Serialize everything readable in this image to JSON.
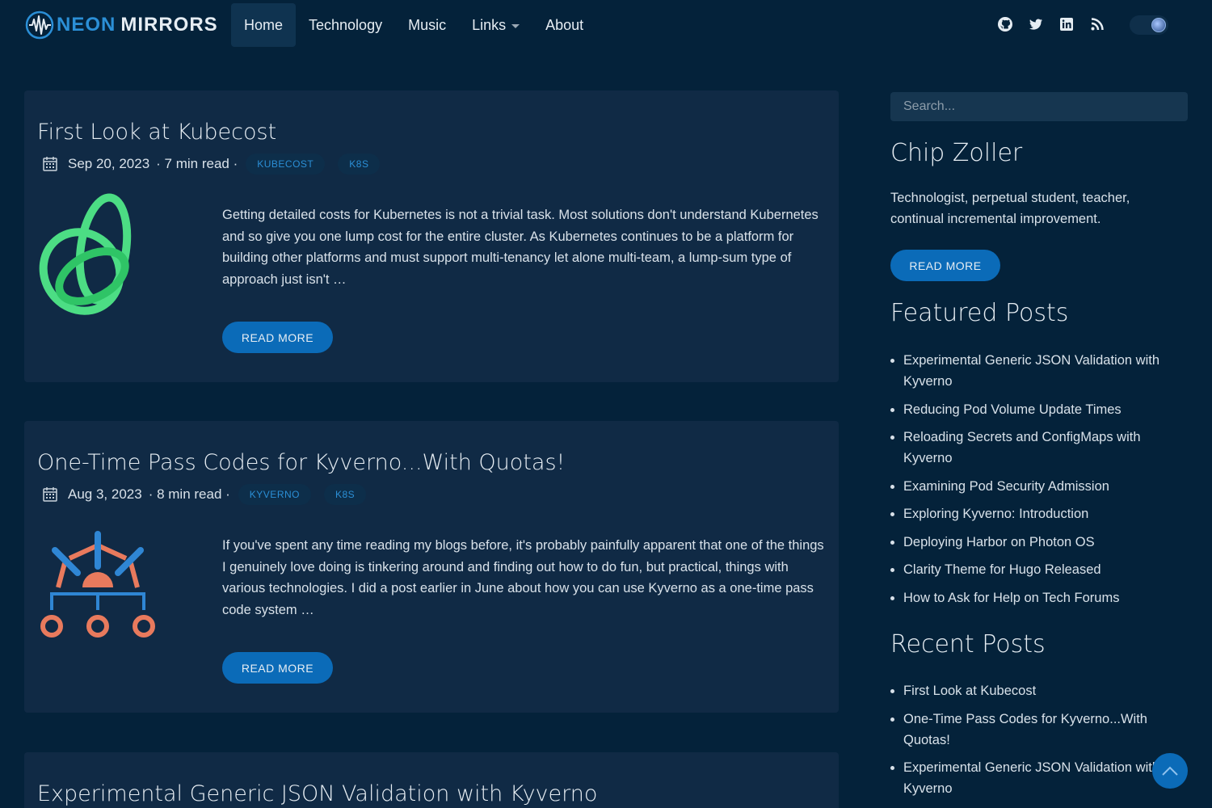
{
  "brand": {
    "neon": "NEON",
    "mirrors": "MIRRORS"
  },
  "nav": {
    "items": [
      {
        "label": "Home",
        "active": true
      },
      {
        "label": "Technology"
      },
      {
        "label": "Music"
      },
      {
        "label": "Links",
        "dropdown": true
      },
      {
        "label": "About"
      }
    ],
    "socials": [
      "github-icon",
      "twitter-icon",
      "linkedin-icon",
      "rss-icon"
    ]
  },
  "posts": [
    {
      "title": "First Look at Kubecost",
      "date": "Sep 20, 2023",
      "read": "· 7 min read ·",
      "tags": [
        "KUBECOST",
        "K8S"
      ],
      "excerpt": "Getting detailed costs for Kubernetes is not a trivial task. Most solutions don't understand Kubernetes and so give you one lump cost for the entire cluster. As Kubernetes continues to be a platform for building other platforms and must support multi-tenancy let alone multi-team, a lump-sum type of approach just isn't …",
      "button": "READ MORE"
    },
    {
      "title": "One-Time Pass Codes for Kyverno...With Quotas!",
      "date": "Aug 3, 2023",
      "read": "· 8 min read ·",
      "tags": [
        "KYVERNO",
        "K8S"
      ],
      "excerpt": "If you've spent any time reading my blogs before, it's probably painfully apparent that one of the things I genuinely love doing is tinkering around and finding out how to do fun, but practical, things with various technologies. I did a post earlier in June about how you can use Kyverno as a one-time pass code system …",
      "button": "READ MORE"
    },
    {
      "title": "Experimental Generic JSON Validation with Kyverno"
    }
  ],
  "sidebar": {
    "search_placeholder": "Search...",
    "author": "Chip Zoller",
    "bio": "Technologist, perpetual student, teacher, continual incremental improvement.",
    "button": "READ MORE",
    "featured_title": "Featured Posts",
    "featured": [
      "Experimental Generic JSON Validation with Kyverno",
      "Reducing Pod Volume Update Times",
      "Reloading Secrets and ConfigMaps with Kyverno",
      "Examining Pod Security Admission",
      "Exploring Kyverno: Introduction",
      "Deploying Harbor on Photon OS",
      "Clarity Theme for Hugo Released",
      "How to Ask for Help on Tech Forums"
    ],
    "recent_title": "Recent Posts",
    "recent": [
      "First Look at Kubecost",
      "One-Time Pass Codes for Kyverno...With Quotas!",
      "Experimental Generic JSON Validation with Kyverno"
    ]
  },
  "colors": {
    "background": "#04223a",
    "card": "#102a45",
    "accent": "#0b6bb8",
    "link": "#2b8fd6"
  }
}
